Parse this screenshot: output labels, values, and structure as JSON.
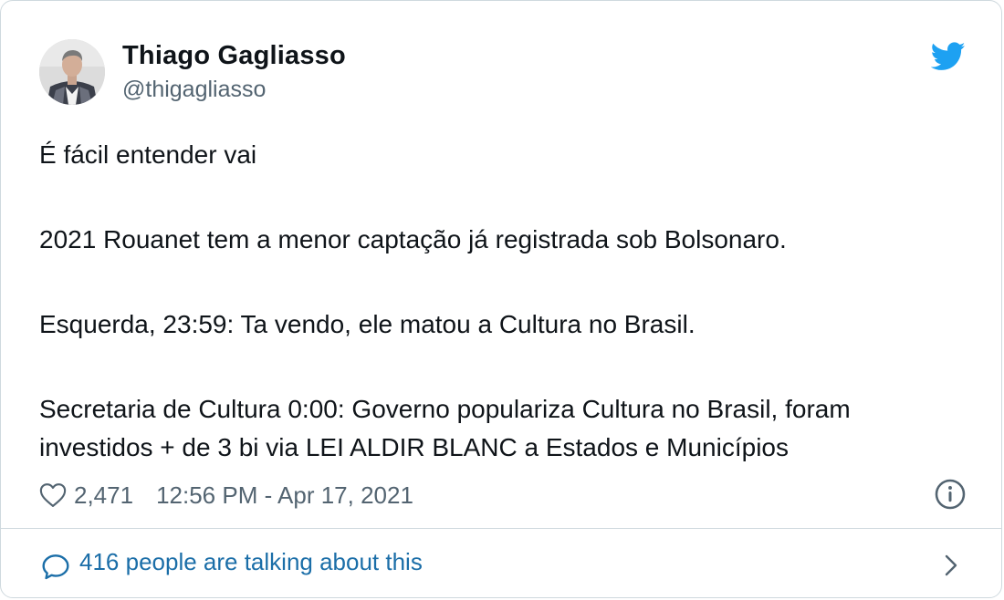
{
  "tweet": {
    "author": {
      "display_name": "Thiago Gagliasso",
      "handle": "@thigagliasso",
      "avatar_icon": "user-avatar"
    },
    "brand_icon": "twitter-bird-icon",
    "brand_color": "#1da1f2",
    "text_paragraphs": [
      [
        "É fácil entender vai"
      ],
      [
        "2021 Rouanet tem a menor captação já registrada sob Bolsonaro."
      ],
      [
        "Esquerda, 23:59: Ta vendo, ele matou a Cultura no Brasil."
      ],
      [
        "Secretaria de Cultura 0:00: Governo populariza Cultura no Brasil, foram",
        "investidos + de 3 bi via LEI ALDIR BLANC a Estados e Municípios"
      ]
    ],
    "likes": "2,471",
    "like_icon": "heart-icon",
    "timestamp": "12:56 PM - Apr 17, 2021",
    "info_icon": "info-icon"
  },
  "footer": {
    "label": "416 people are talking about this",
    "icon": "speech-bubble-icon",
    "chevron_icon": "chevron-right-icon",
    "link_color": "#1b6ea8"
  }
}
